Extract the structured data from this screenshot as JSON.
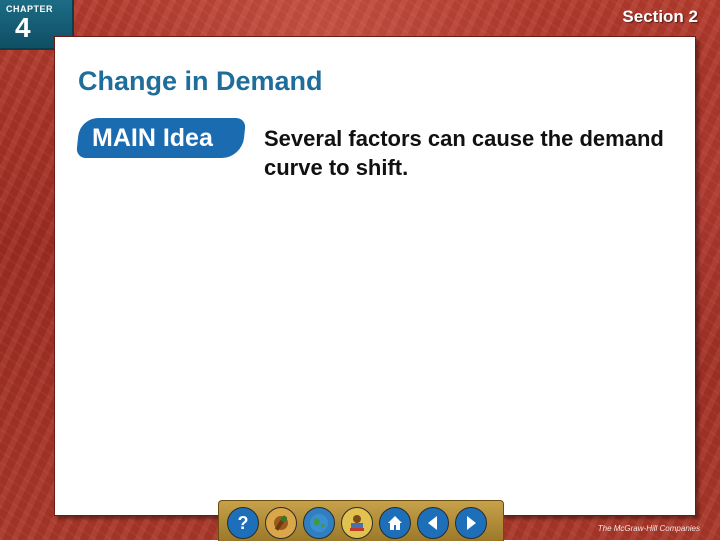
{
  "header": {
    "chapter_label": "CHAPTER",
    "chapter_number": "4",
    "section_label": "Section 2"
  },
  "slide": {
    "title": "Change in Demand",
    "main_idea_badge": "MAIN Idea",
    "main_idea_text": "Several factors can cause the demand curve to shift."
  },
  "navigation": {
    "buttons": [
      {
        "name": "help-button",
        "icon": "question-mark-icon",
        "color": "#1c6fb8"
      },
      {
        "name": "tools-button",
        "icon": "tools-icon",
        "color": "#d9a64a"
      },
      {
        "name": "globe-button",
        "icon": "globe-icon",
        "color": "#2f7fc1"
      },
      {
        "name": "resources-button",
        "icon": "resources-icon",
        "color": "#e2c24f"
      },
      {
        "name": "home-button",
        "icon": "home-icon",
        "color": "#1c6fb8"
      },
      {
        "name": "previous-button",
        "icon": "arrow-left-icon",
        "color": "#1c6fb8"
      },
      {
        "name": "next-button",
        "icon": "arrow-right-icon",
        "color": "#1c6fb8"
      }
    ]
  },
  "footer": {
    "publisher": "The McGraw-Hill Companies"
  },
  "colors": {
    "background": "#a83628",
    "title": "#1f6d9a",
    "badge": "#1a6bb0",
    "chapter_tab": "#155d74"
  }
}
